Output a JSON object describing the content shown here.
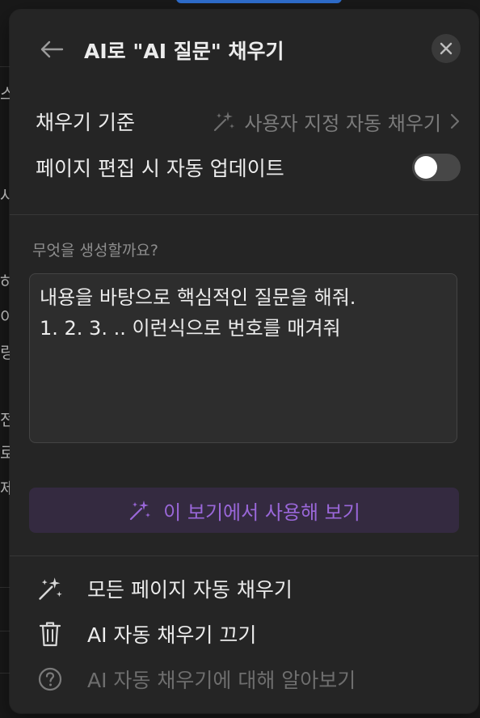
{
  "header": {
    "title": "AI로 \"AI 질문\" 채우기"
  },
  "settings": {
    "fill_basis_label": "채우기 기준",
    "fill_basis_value": "사용자 지정 자동 채우기",
    "auto_update_label": "페이지 편집 시 자동 업데이트",
    "auto_update_on": false
  },
  "prompt": {
    "label": "무엇을 생성할까요?",
    "lines": [
      "내용을 바탕으로 핵심적인 질문을 해줘.",
      "1. 2. 3. .. 이런식으로 번호를 매겨줘"
    ]
  },
  "try_button": {
    "label": "이 보기에서 사용해 보기"
  },
  "menu": {
    "autofill_all": "모든 페이지 자동 채우기",
    "disable_autofill": "AI 자동 채우기 끄기",
    "learn_more": "AI 자동 채우기에 대해 알아보기"
  },
  "background_fragments": [
    "스",
    "사",
    "하",
    "이",
    "링",
    "전",
    "로",
    "제"
  ],
  "colors": {
    "panel_bg": "#252525",
    "accent_purple": "#9a67d9",
    "try_button_bg": "#342a40",
    "muted_text": "#7b7b7b"
  }
}
